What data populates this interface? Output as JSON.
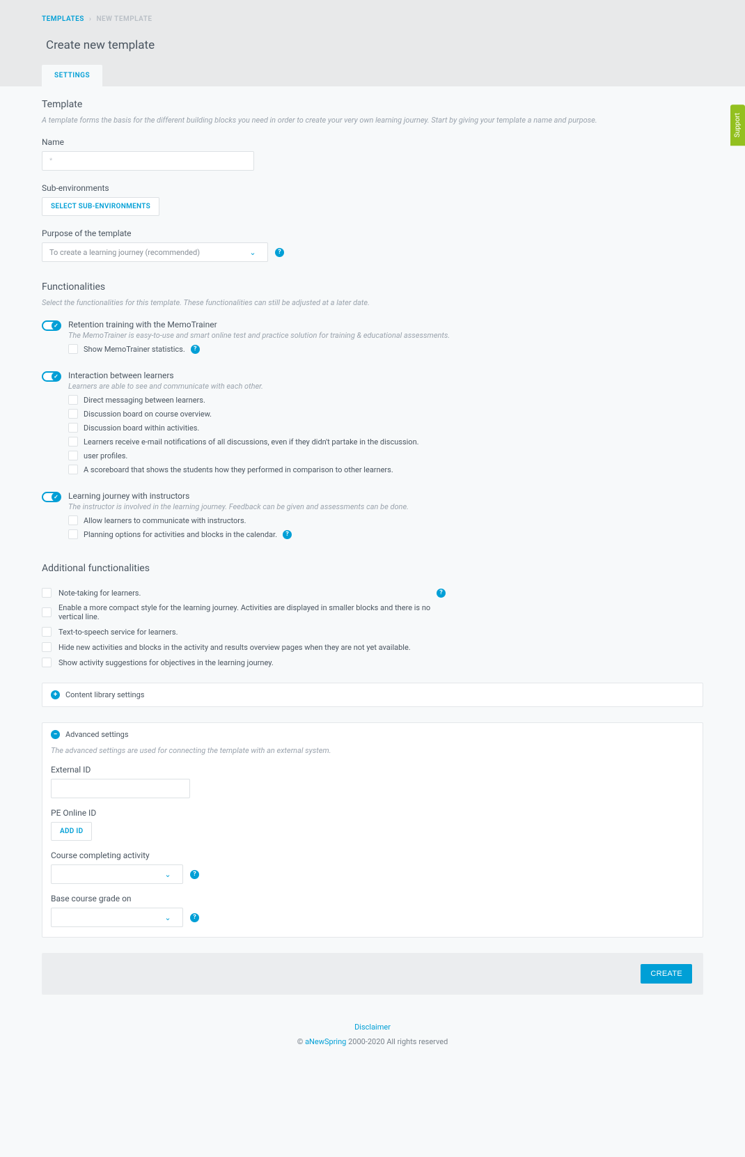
{
  "breadcrumb": {
    "root": "TEMPLATES",
    "current": "NEW TEMPLATE"
  },
  "pageTitle": "Create new template",
  "tab": "SETTINGS",
  "support": "Support",
  "template": {
    "heading": "Template",
    "desc": "A template forms the basis for the different building blocks you need in order to create your very own learning journey. Start by giving your template a name and purpose.",
    "nameLabel": "Name",
    "namePlaceholder": "*",
    "subEnvLabel": "Sub-environments",
    "subEnvButton": "SELECT SUB-ENVIRONMENTS",
    "purposeLabel": "Purpose of the template",
    "purposeValue": "To create a learning journey (recommended)"
  },
  "functionalities": {
    "heading": "Functionalities",
    "desc": "Select the functionalities for this template. These functionalities can still be adjusted at a later date.",
    "items": [
      {
        "title": "Retention training with the MemoTrainer",
        "desc": "The MemoTrainer is easy-to-use and smart online test and practice solution for training & educational assessments.",
        "subs": [
          {
            "label": "Show MemoTrainer statistics.",
            "help": true
          }
        ]
      },
      {
        "title": "Interaction between learners",
        "desc": "Learners are able to see and communicate with each other.",
        "subs": [
          {
            "label": "Direct messaging between learners."
          },
          {
            "label": "Discussion board on course overview."
          },
          {
            "label": "Discussion board within activities."
          },
          {
            "label": "Learners receive e-mail notifications of all discussions, even if they didn't partake in the discussion."
          },
          {
            "label": "user profiles."
          },
          {
            "label": "A scoreboard that shows the students how they performed in comparison to other learners."
          }
        ]
      },
      {
        "title": "Learning journey with instructors",
        "desc": "The instructor is involved in the learning journey. Feedback can be given and assessments can be done.",
        "subs": [
          {
            "label": "Allow learners to communicate with instructors."
          },
          {
            "label": "Planning options for activities and blocks in the calendar.",
            "help": true
          }
        ]
      }
    ]
  },
  "additional": {
    "heading": "Additional functionalities",
    "items": [
      {
        "label": "Note-taking for learners.",
        "help": true
      },
      {
        "label": "Enable a more compact style for the learning journey. Activities are displayed in smaller blocks and there is no vertical line."
      },
      {
        "label": "Text-to-speech service for learners."
      },
      {
        "label": "Hide new activities and blocks in the activity and results overview pages when they are not yet available."
      },
      {
        "label": "Show activity suggestions for objectives in the learning journey."
      }
    ]
  },
  "contentLibrary": {
    "title": "Content library settings"
  },
  "advanced": {
    "title": "Advanced settings",
    "desc": "The advanced settings are used for connecting the template with an external system.",
    "externalIdLabel": "External ID",
    "peLabel": "PE Online ID",
    "peButton": "ADD ID",
    "ccaLabel": "Course completing activity",
    "baseGradeLabel": "Base course grade on"
  },
  "createButton": "CREATE",
  "footer": {
    "disclaimer": "Disclaimer",
    "brand": "aNewSpring",
    "copy": "© ",
    "rights": " 2000-2020 All rights reserved"
  }
}
